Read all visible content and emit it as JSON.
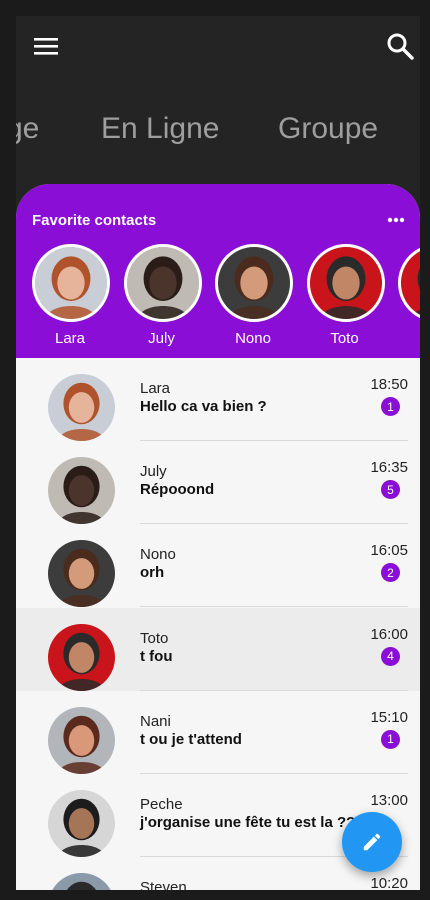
{
  "header": {
    "menu_icon": "menu-icon",
    "search_icon": "search-icon"
  },
  "tabs": [
    "ge",
    "En Ligne",
    "Groupe"
  ],
  "favorites": {
    "title": "Favorite contacts",
    "more_icon": "more-horizontal-icon",
    "contacts": [
      {
        "name": "Lara",
        "skin": "#e6b49b",
        "hair": "#b0532c",
        "bg": "#c8cdd6"
      },
      {
        "name": "July",
        "skin": "#4a342b",
        "hair": "#2a1d18",
        "bg": "#bfbab3"
      },
      {
        "name": "Nono",
        "skin": "#d49b7a",
        "hair": "#4a2b1e",
        "bg": "#3c3c3c"
      },
      {
        "name": "Toto",
        "skin": "#c08665",
        "hair": "#2a2a2a",
        "bg": "#c8141a"
      }
    ]
  },
  "chats": [
    {
      "name": "Lara",
      "message": "Hello ca va bien ?",
      "time": "18:50",
      "unread": "1",
      "skin": "#e6b49b",
      "hair": "#b0532c",
      "bg": "#c8cdd6"
    },
    {
      "name": "July",
      "message": "Répooond",
      "time": "16:35",
      "unread": "5",
      "skin": "#4a342b",
      "hair": "#2a1d18",
      "bg": "#bfbab3"
    },
    {
      "name": "Nono",
      "message": "orh",
      "time": "16:05",
      "unread": "2",
      "skin": "#d49b7a",
      "hair": "#4a2b1e",
      "bg": "#3c3c3c"
    },
    {
      "name": "Toto",
      "message": "t fou",
      "time": "16:00",
      "unread": "4",
      "skin": "#c08665",
      "hair": "#2a2a2a",
      "bg": "#c8141a",
      "selected": true
    },
    {
      "name": "Nani",
      "message": "t ou je t'attend",
      "time": "15:10",
      "unread": "1",
      "skin": "#d9987a",
      "hair": "#5a2a1c",
      "bg": "#b2b6ba"
    },
    {
      "name": "Peche",
      "message": "j'organise une fête tu est la ??",
      "time": "13:00",
      "unread": "",
      "skin": "#a57558",
      "hair": "#1c1c1c",
      "bg": "#d6d6d6"
    },
    {
      "name": "Steven",
      "message": "",
      "time": "10:20",
      "unread": "",
      "skin": "#a07a60",
      "hair": "#2a2a2a",
      "bg": "#8a9aa8"
    }
  ],
  "fab": {
    "icon": "edit-pencil-icon"
  },
  "colors": {
    "accent": "#8a0ed6",
    "fab": "#2196f3",
    "background": "#242424"
  }
}
